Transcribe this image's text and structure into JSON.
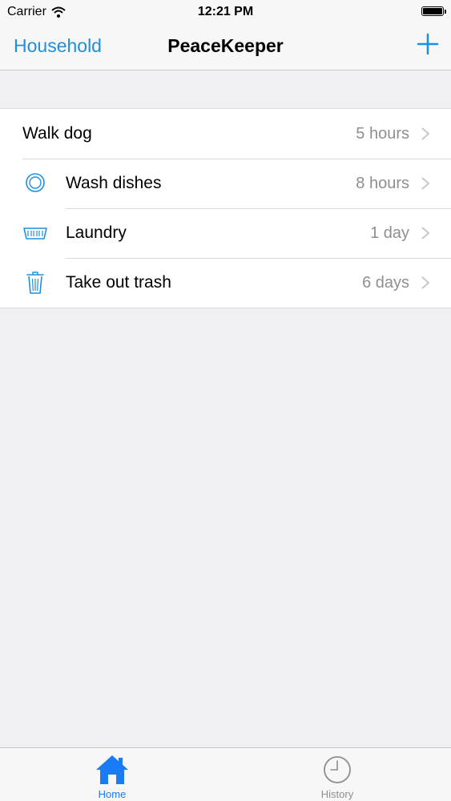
{
  "status_bar": {
    "carrier": "Carrier",
    "time": "12:21 PM"
  },
  "nav": {
    "left_label": "Household",
    "title": "PeaceKeeper",
    "add_icon": "plus-icon"
  },
  "chores": [
    {
      "title": "Walk dog",
      "detail": "5 hours",
      "icon": "none"
    },
    {
      "title": "Wash dishes",
      "detail": "8 hours",
      "icon": "dish-icon"
    },
    {
      "title": "Laundry",
      "detail": "1 day",
      "icon": "laundry-basket-icon"
    },
    {
      "title": "Take out trash",
      "detail": "6 days",
      "icon": "trash-icon"
    }
  ],
  "tabs": [
    {
      "label": "Home",
      "icon": "home-icon",
      "selected": true
    },
    {
      "label": "History",
      "icon": "clock-icon",
      "selected": false
    }
  ],
  "colors": {
    "accent": "#1f8fdc",
    "tab_selected": "#1a7cf5",
    "tab_unselected": "#8e8e93"
  }
}
